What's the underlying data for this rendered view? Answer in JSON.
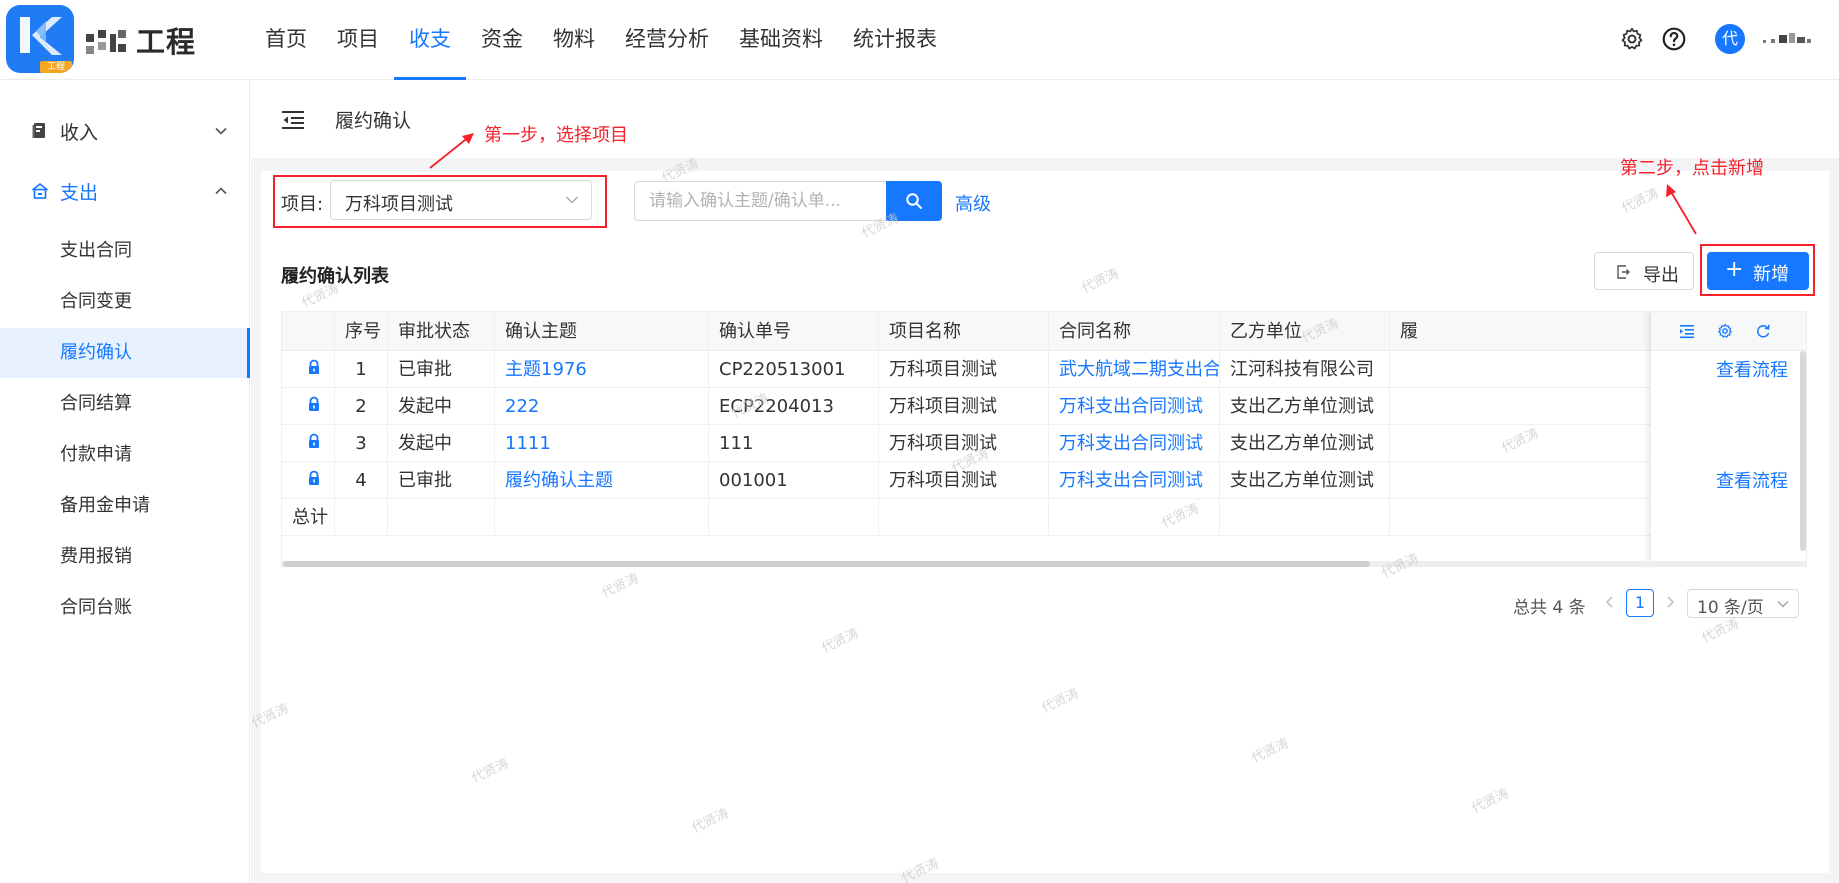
{
  "app": {
    "brand": "工程",
    "logo_tag": "工程"
  },
  "nav": {
    "items": [
      "首页",
      "项目",
      "收支",
      "资金",
      "物料",
      "经营分析",
      "基础资料",
      "统计报表"
    ],
    "active_index": 2
  },
  "header": {
    "avatar_text": "代"
  },
  "sidebar": {
    "groups": [
      {
        "label": "收入",
        "icon": "book-icon",
        "open": false
      },
      {
        "label": "支出",
        "icon": "home-icon",
        "open": true
      }
    ],
    "items": [
      "支出合同",
      "合同变更",
      "履约确认",
      "合同结算",
      "付款申请",
      "备用金申请",
      "费用报销",
      "合同台账"
    ],
    "active_item": "履约确认"
  },
  "page": {
    "title": "履约确认"
  },
  "annotations": {
    "step1": "第一步，选择项目",
    "step2": "第二步，点击新增"
  },
  "filter": {
    "project_label": "项目:",
    "project_value": "万科项目测试",
    "search_placeholder": "请输入确认主题/确认单...",
    "advanced_label": "高级"
  },
  "list": {
    "title": "履约确认列表",
    "export_label": "导出",
    "add_label": "新增"
  },
  "table": {
    "columns": [
      "序号",
      "审批状态",
      "确认主题",
      "确认单号",
      "项目名称",
      "合同名称",
      "乙方单位",
      "履"
    ],
    "rows": [
      {
        "index": "1",
        "status": "已审批",
        "subject": "主题1976",
        "number": "CP220513001",
        "project": "万科项目测试",
        "contract": "武大航域二期支出合同",
        "party_b": "江河科技有限公司",
        "action": "查看流程"
      },
      {
        "index": "2",
        "status": "发起中",
        "subject": "222",
        "number": "ECP2204013",
        "project": "万科项目测试",
        "contract": "万科支出合同测试",
        "party_b": "支出乙方单位测试",
        "action": ""
      },
      {
        "index": "3",
        "status": "发起中",
        "subject": "1111",
        "number": "111",
        "project": "万科项目测试",
        "contract": "万科支出合同测试",
        "party_b": "支出乙方单位测试",
        "action": ""
      },
      {
        "index": "4",
        "status": "已审批",
        "subject": "履约确认主题",
        "number": "001001",
        "project": "万科项目测试",
        "contract": "万科支出合同测试",
        "party_b": "支出乙方单位测试",
        "action": "查看流程"
      }
    ],
    "total_label": "总计"
  },
  "pagination": {
    "total_text": "总共 4 条",
    "current_page": "1",
    "page_size": "10 条/页"
  },
  "watermark": "代贤涛",
  "colors": {
    "accent": "#1677ff",
    "annotation": "#f5222d"
  }
}
